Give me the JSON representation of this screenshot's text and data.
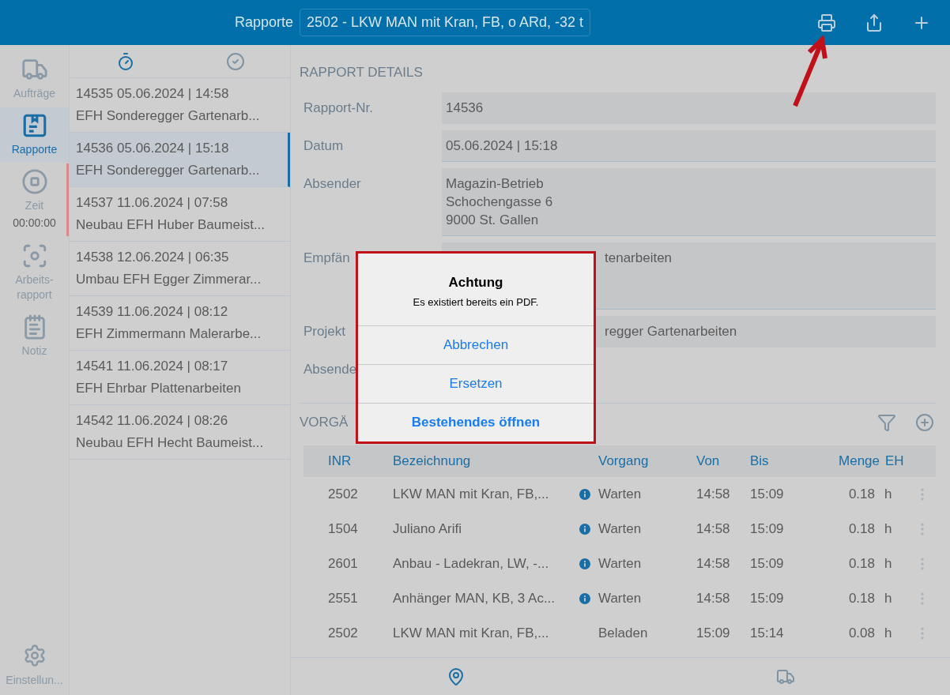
{
  "header": {
    "title": "Rapporte",
    "selector": "2502 - LKW MAN mit Kran, FB, o ARd, -32 t"
  },
  "sidebar": {
    "items": [
      {
        "kind": "truck",
        "label": "Aufträge",
        "selected": false
      },
      {
        "kind": "report",
        "label": "Rapporte",
        "selected": true
      },
      {
        "kind": "timer",
        "label": "Zeit",
        "value": "00:00:00",
        "selected": false,
        "running": true
      },
      {
        "kind": "focus",
        "label": "Arbeits-rapport",
        "selected": false
      },
      {
        "kind": "note",
        "label": "Notiz",
        "selected": false
      }
    ],
    "settings": {
      "label": "Einstellun..."
    }
  },
  "list": {
    "tabs": [
      {
        "kind": "timer",
        "selected": true
      },
      {
        "kind": "done",
        "selected": false
      }
    ],
    "items": [
      {
        "id": "14535",
        "date": "05.06.2024 | 14:58",
        "title": "EFH Sonderegger Gartenarb...",
        "selected": false
      },
      {
        "id": "14536",
        "date": "05.06.2024 | 15:18",
        "title": "EFH Sonderegger Gartenarb...",
        "selected": true
      },
      {
        "id": "14537",
        "date": "11.06.2024 | 07:58",
        "title": "Neubau EFH Huber Baumeist...",
        "selected": false
      },
      {
        "id": "14538",
        "date": "12.06.2024 | 06:35",
        "title": "Umbau EFH Egger Zimmerar...",
        "selected": false
      },
      {
        "id": "14539",
        "date": "11.06.2024 | 08:12",
        "title": "EFH Zimmermann Malerarbe...",
        "selected": false
      },
      {
        "id": "14541",
        "date": "11.06.2024 | 08:17",
        "title": "EFH Ehrbar Plattenarbeiten",
        "selected": false
      },
      {
        "id": "14542",
        "date": "11.06.2024 | 08:26",
        "title": "Neubau EFH Hecht Baumeist...",
        "selected": false
      }
    ]
  },
  "details": {
    "heading": "RAPPORT DETAILS",
    "fields": [
      {
        "label": "Rapport-Nr.",
        "lines": [
          "14536"
        ]
      },
      {
        "label": "Datum",
        "lines": [
          "05.06.2024 | 15:18"
        ]
      },
      {
        "label": "Absender",
        "lines": [
          "Magazin-Betrieb",
          "Schochengasse 6",
          "9000 St. Gallen"
        ]
      },
      {
        "label": "Empfän",
        "lines": [
          "tenarbeiten"
        ],
        "covered": true,
        "tall": true
      },
      {
        "label": "Projekt",
        "lines": [
          "regger Gartenarbeiten"
        ],
        "covered": true
      },
      {
        "label": "Absende"
      }
    ]
  },
  "vorgaenge": {
    "heading": "VORGÄ",
    "columns": [
      "INR",
      "Bezeichnung",
      "Vorgang",
      "Von",
      "Bis",
      "Menge",
      "EH"
    ],
    "rows": [
      {
        "inr": "2502",
        "bezeichnung": "LKW MAN mit Kran, FB,...",
        "info": true,
        "vorgang": "Warten",
        "von": "14:58",
        "bis": "15:09",
        "menge": "0.18",
        "eh": "h"
      },
      {
        "inr": "1504",
        "bezeichnung": "Juliano Arifi",
        "info": true,
        "vorgang": "Warten",
        "von": "14:58",
        "bis": "15:09",
        "menge": "0.18",
        "eh": "h"
      },
      {
        "inr": "2601",
        "bezeichnung": "Anbau - Ladekran, LW, -...",
        "info": true,
        "vorgang": "Warten",
        "von": "14:58",
        "bis": "15:09",
        "menge": "0.18",
        "eh": "h"
      },
      {
        "inr": "2551",
        "bezeichnung": "Anhänger MAN, KB, 3 Ac...",
        "info": true,
        "vorgang": "Warten",
        "von": "14:58",
        "bis": "15:09",
        "menge": "0.18",
        "eh": "h"
      },
      {
        "inr": "2502",
        "bezeichnung": "LKW MAN mit Kran, FB,...",
        "info": false,
        "vorgang": "Beladen",
        "von": "15:09",
        "bis": "15:14",
        "menge": "0.08",
        "eh": "h"
      }
    ]
  },
  "bottom_bar": [
    {
      "kind": "pin",
      "selected": true
    },
    {
      "kind": "truck",
      "selected": false
    }
  ],
  "dialog": {
    "title": "Achtung",
    "message": "Es existiert bereits ein PDF.",
    "buttons": [
      {
        "label": "Abbrechen",
        "primary": false
      },
      {
        "label": "Ersetzen",
        "primary": false
      },
      {
        "label": "Bestehendes öffnen",
        "primary": true
      }
    ]
  }
}
